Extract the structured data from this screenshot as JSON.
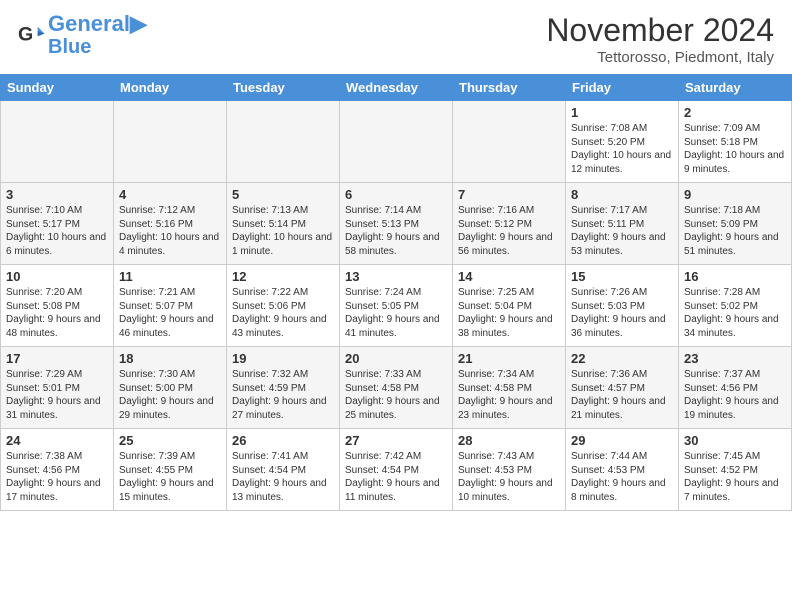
{
  "header": {
    "logo_line1": "General",
    "logo_line2": "Blue",
    "month": "November 2024",
    "location": "Tettorosso, Piedmont, Italy"
  },
  "days_of_week": [
    "Sunday",
    "Monday",
    "Tuesday",
    "Wednesday",
    "Thursday",
    "Friday",
    "Saturday"
  ],
  "weeks": [
    [
      {
        "day": "",
        "empty": true
      },
      {
        "day": "",
        "empty": true
      },
      {
        "day": "",
        "empty": true
      },
      {
        "day": "",
        "empty": true
      },
      {
        "day": "",
        "empty": true
      },
      {
        "day": "1",
        "info": "Sunrise: 7:08 AM\nSunset: 5:20 PM\nDaylight: 10 hours and 12 minutes."
      },
      {
        "day": "2",
        "info": "Sunrise: 7:09 AM\nSunset: 5:18 PM\nDaylight: 10 hours and 9 minutes."
      }
    ],
    [
      {
        "day": "3",
        "info": "Sunrise: 7:10 AM\nSunset: 5:17 PM\nDaylight: 10 hours and 6 minutes."
      },
      {
        "day": "4",
        "info": "Sunrise: 7:12 AM\nSunset: 5:16 PM\nDaylight: 10 hours and 4 minutes."
      },
      {
        "day": "5",
        "info": "Sunrise: 7:13 AM\nSunset: 5:14 PM\nDaylight: 10 hours and 1 minute."
      },
      {
        "day": "6",
        "info": "Sunrise: 7:14 AM\nSunset: 5:13 PM\nDaylight: 9 hours and 58 minutes."
      },
      {
        "day": "7",
        "info": "Sunrise: 7:16 AM\nSunset: 5:12 PM\nDaylight: 9 hours and 56 minutes."
      },
      {
        "day": "8",
        "info": "Sunrise: 7:17 AM\nSunset: 5:11 PM\nDaylight: 9 hours and 53 minutes."
      },
      {
        "day": "9",
        "info": "Sunrise: 7:18 AM\nSunset: 5:09 PM\nDaylight: 9 hours and 51 minutes."
      }
    ],
    [
      {
        "day": "10",
        "info": "Sunrise: 7:20 AM\nSunset: 5:08 PM\nDaylight: 9 hours and 48 minutes."
      },
      {
        "day": "11",
        "info": "Sunrise: 7:21 AM\nSunset: 5:07 PM\nDaylight: 9 hours and 46 minutes."
      },
      {
        "day": "12",
        "info": "Sunrise: 7:22 AM\nSunset: 5:06 PM\nDaylight: 9 hours and 43 minutes."
      },
      {
        "day": "13",
        "info": "Sunrise: 7:24 AM\nSunset: 5:05 PM\nDaylight: 9 hours and 41 minutes."
      },
      {
        "day": "14",
        "info": "Sunrise: 7:25 AM\nSunset: 5:04 PM\nDaylight: 9 hours and 38 minutes."
      },
      {
        "day": "15",
        "info": "Sunrise: 7:26 AM\nSunset: 5:03 PM\nDaylight: 9 hours and 36 minutes."
      },
      {
        "day": "16",
        "info": "Sunrise: 7:28 AM\nSunset: 5:02 PM\nDaylight: 9 hours and 34 minutes."
      }
    ],
    [
      {
        "day": "17",
        "info": "Sunrise: 7:29 AM\nSunset: 5:01 PM\nDaylight: 9 hours and 31 minutes."
      },
      {
        "day": "18",
        "info": "Sunrise: 7:30 AM\nSunset: 5:00 PM\nDaylight: 9 hours and 29 minutes."
      },
      {
        "day": "19",
        "info": "Sunrise: 7:32 AM\nSunset: 4:59 PM\nDaylight: 9 hours and 27 minutes."
      },
      {
        "day": "20",
        "info": "Sunrise: 7:33 AM\nSunset: 4:58 PM\nDaylight: 9 hours and 25 minutes."
      },
      {
        "day": "21",
        "info": "Sunrise: 7:34 AM\nSunset: 4:58 PM\nDaylight: 9 hours and 23 minutes."
      },
      {
        "day": "22",
        "info": "Sunrise: 7:36 AM\nSunset: 4:57 PM\nDaylight: 9 hours and 21 minutes."
      },
      {
        "day": "23",
        "info": "Sunrise: 7:37 AM\nSunset: 4:56 PM\nDaylight: 9 hours and 19 minutes."
      }
    ],
    [
      {
        "day": "24",
        "info": "Sunrise: 7:38 AM\nSunset: 4:56 PM\nDaylight: 9 hours and 17 minutes."
      },
      {
        "day": "25",
        "info": "Sunrise: 7:39 AM\nSunset: 4:55 PM\nDaylight: 9 hours and 15 minutes."
      },
      {
        "day": "26",
        "info": "Sunrise: 7:41 AM\nSunset: 4:54 PM\nDaylight: 9 hours and 13 minutes."
      },
      {
        "day": "27",
        "info": "Sunrise: 7:42 AM\nSunset: 4:54 PM\nDaylight: 9 hours and 11 minutes."
      },
      {
        "day": "28",
        "info": "Sunrise: 7:43 AM\nSunset: 4:53 PM\nDaylight: 9 hours and 10 minutes."
      },
      {
        "day": "29",
        "info": "Sunrise: 7:44 AM\nSunset: 4:53 PM\nDaylight: 9 hours and 8 minutes."
      },
      {
        "day": "30",
        "info": "Sunrise: 7:45 AM\nSunset: 4:52 PM\nDaylight: 9 hours and 7 minutes."
      }
    ]
  ]
}
